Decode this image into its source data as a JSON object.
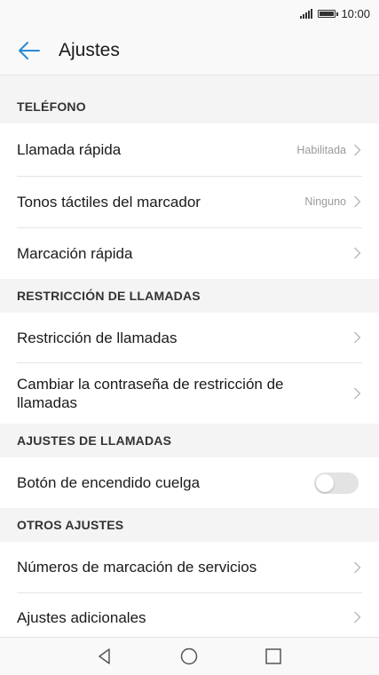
{
  "status": {
    "time": "10:00"
  },
  "appbar": {
    "title": "Ajustes"
  },
  "sections": [
    {
      "header": "TELÉFONO",
      "items": [
        {
          "label": "Llamada rápida",
          "value": "Habilitada"
        },
        {
          "label": "Tonos táctiles del marcador",
          "value": "Ninguno"
        },
        {
          "label": "Marcación rápida"
        }
      ]
    },
    {
      "header": "RESTRICCIÓN DE LLAMADAS",
      "items": [
        {
          "label": "Restricción de llamadas"
        },
        {
          "label": "Cambiar la contraseña de restricción de llamadas"
        }
      ]
    },
    {
      "header": "AJUSTES DE LLAMADAS",
      "items": [
        {
          "label": "Botón de encendido cuelga",
          "toggle": false
        }
      ]
    },
    {
      "header": "OTROS AJUSTES",
      "items": [
        {
          "label": "Números de marcación de servicios"
        },
        {
          "label": "Ajustes adicionales"
        }
      ]
    }
  ],
  "colors": {
    "accent": "#2a8ad6",
    "background": "#f4f4f4"
  },
  "icons": [
    "signal-icon",
    "battery-icon",
    "back-arrow-icon",
    "chevron-right-icon",
    "nav-back-icon",
    "nav-home-icon",
    "nav-recents-icon"
  ]
}
